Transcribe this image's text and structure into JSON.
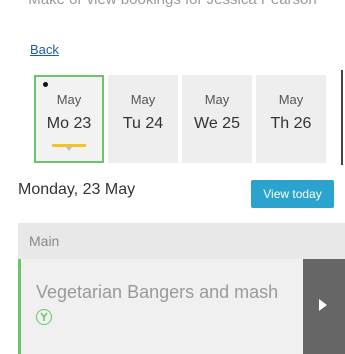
{
  "header": {
    "intro_text": "Make or view bookings for Jessica Pearson",
    "back_label": "Back"
  },
  "days": [
    {
      "month": "May",
      "label": "Mo 23",
      "selected": true
    },
    {
      "month": "May",
      "label": "Tu 24",
      "selected": false
    },
    {
      "month": "May",
      "label": "We 25",
      "selected": false
    },
    {
      "month": "May",
      "label": "Th 26",
      "selected": false
    }
  ],
  "selected_day": {
    "heading": "Monday, 23 May",
    "view_today_label": "View today"
  },
  "section": {
    "title": "Main"
  },
  "meal": {
    "name": "Vegetarian Bangers and mash",
    "diet_icon": "vegetarian-icon"
  },
  "colors": {
    "accent_green": "#6cc36b",
    "button_blue": "#2aa3cf",
    "underline_yellow": "#f2c12e"
  }
}
